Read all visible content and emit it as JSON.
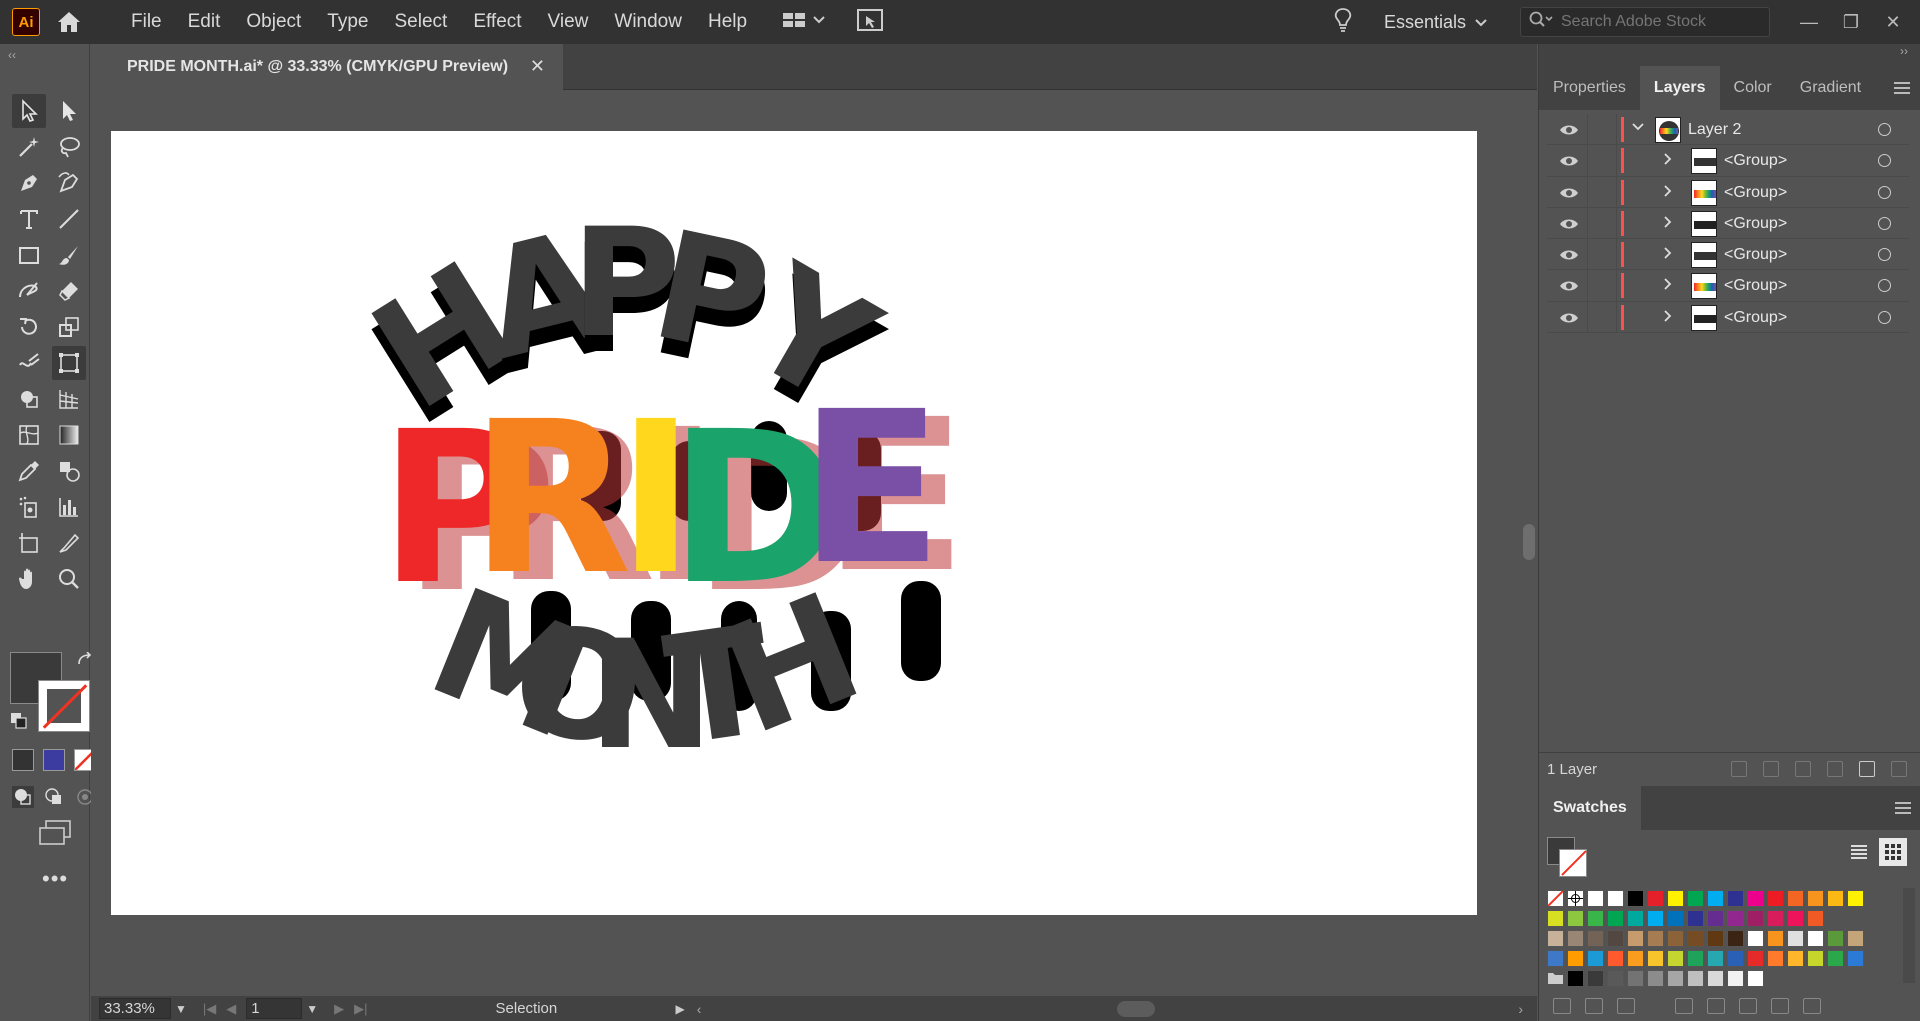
{
  "menubar": {
    "logo": "Ai",
    "items": [
      "File",
      "Edit",
      "Object",
      "Type",
      "Select",
      "Effect",
      "View",
      "Window",
      "Help"
    ],
    "workspace": "Essentials",
    "search_placeholder": "Search Adobe Stock"
  },
  "document": {
    "tab_title": "PRIDE MONTH.ai* @ 33.33% (CMYK/GPU Preview)",
    "artwork": {
      "top_word": [
        "H",
        "A",
        "P",
        "P",
        "Y"
      ],
      "middle_word": [
        "P",
        "R",
        "I",
        "D",
        "E"
      ],
      "bottom_word": [
        "M",
        "O",
        "N",
        "T",
        "H"
      ],
      "text_color": "#3b3b3b",
      "shadow_color": "#000000",
      "rainbow": [
        "#ee2828",
        "#f6821f",
        "#ffd81e",
        "#79b83c",
        "#1aa36a",
        "#1f5fb0",
        "#7a4fa6"
      ]
    }
  },
  "statusbar": {
    "zoom": "33.33%",
    "page": "1",
    "mode": "Selection"
  },
  "panels": {
    "tabs": [
      "Properties",
      "Layers",
      "Color",
      "Gradient"
    ],
    "active_tab": "Layers",
    "layer_color": "#ff4f4f",
    "layers": [
      {
        "name": "Layer 2",
        "type": "layer"
      },
      {
        "name": "<Group>",
        "type": "group",
        "thumb": "happy"
      },
      {
        "name": "<Group>",
        "type": "group",
        "thumb": "pride"
      },
      {
        "name": "<Group>",
        "type": "group",
        "thumb": "month"
      },
      {
        "name": "<Group>",
        "type": "group",
        "thumb": "happy"
      },
      {
        "name": "<Group>",
        "type": "group",
        "thumb": "pride"
      },
      {
        "name": "<Group>",
        "type": "group",
        "thumb": "month"
      }
    ],
    "layers_count": "1 Layer",
    "swatches_title": "Swatches"
  },
  "swatches": {
    "rows": [
      [
        "none",
        "reg",
        "#ffffff",
        "#ffffff",
        "#000000",
        "#e6202b",
        "#fff200",
        "#00a650",
        "#00aeef",
        "#2e3192",
        "#ec008c",
        "#ed1c24",
        "#f26522",
        "#f7941d",
        "#fdb913",
        "#fff200"
      ],
      [
        "#d7df23",
        "#8dc63f",
        "#39b54a",
        "#00a651",
        "#00a99d",
        "#00aeef",
        "#0072bc",
        "#2e3192",
        "#662d91",
        "#92278f",
        "#9e1f63",
        "#d91c5c",
        "#ed145b",
        "#f15a24"
      ],
      [
        "#c7b299",
        "#998675",
        "#736357",
        "#534741",
        "#c69c6d",
        "#a67c52",
        "#8c6239",
        "#754c24",
        "#603913",
        "#3c2415",
        "#ffffff",
        "#f7941d",
        "#e0e0e0",
        "#ffffff",
        "#5a9a3a",
        "#c4a57a"
      ],
      [
        "#3e79c8",
        "#ff9c00",
        "#1c9ad6",
        "#ff5a2e",
        "#fa9c1e",
        "#f7c52b",
        "#c4d52f",
        "#1fa35a",
        "#27a8b0",
        "#2a60b5",
        "#e52a2a",
        "#ff7a2a",
        "#ffb62a",
        "#c7d62a",
        "#2aa84a",
        "#2a7ad6"
      ],
      [
        "folder",
        "#000000",
        "#3a3a3a",
        "#595959",
        "#737373",
        "#8c8c8c",
        "#a6a6a6",
        "#bfbfbf",
        "#d9d9d9",
        "#f2f2f2",
        "#ffffff"
      ]
    ]
  }
}
